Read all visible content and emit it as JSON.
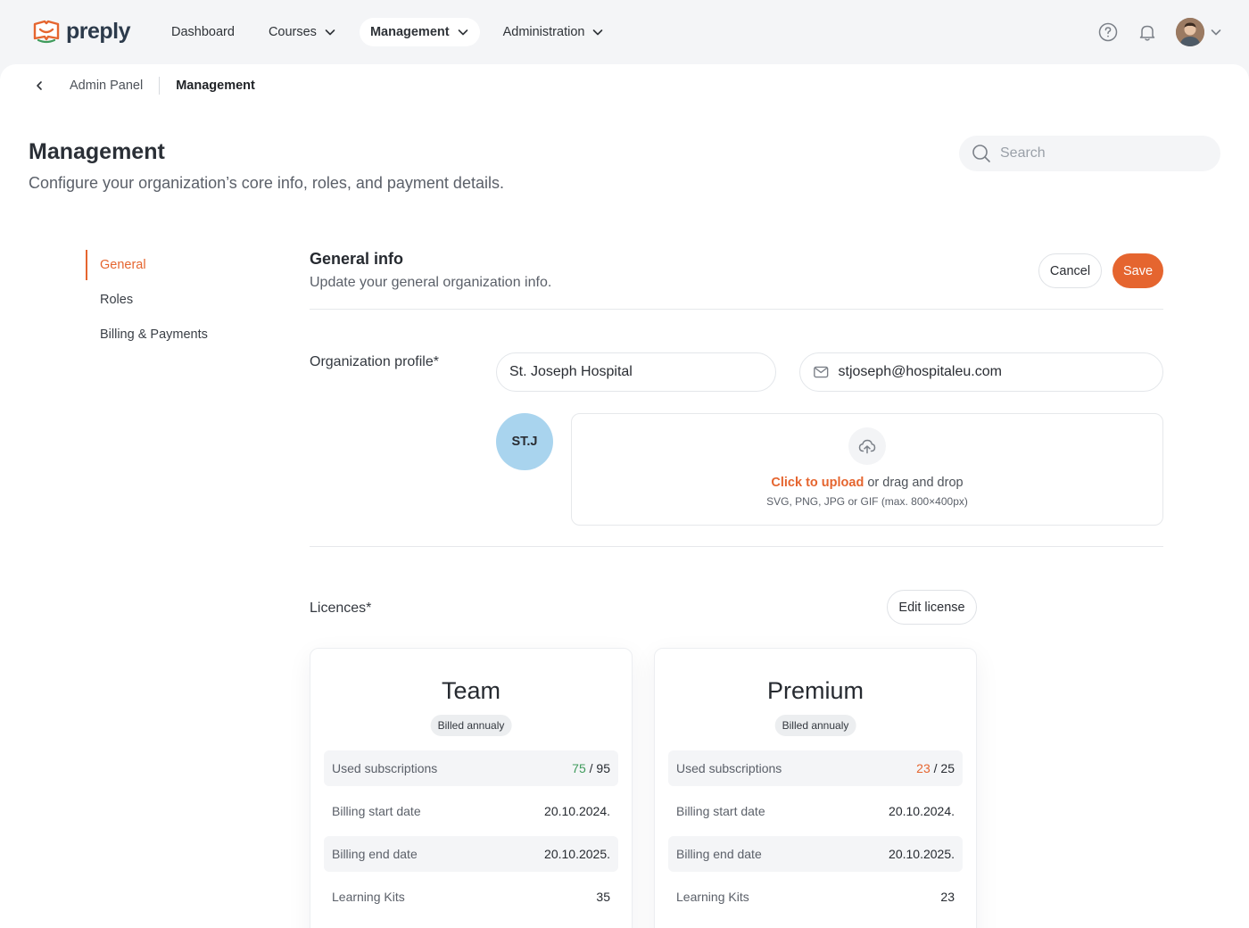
{
  "brand": {
    "name": "preply",
    "accent": "#e5652f"
  },
  "nav": {
    "items": [
      {
        "label": "Dashboard"
      },
      {
        "label": "Courses"
      },
      {
        "label": "Management"
      },
      {
        "label": "Administration"
      }
    ]
  },
  "breadcrumb": {
    "parent": "Admin Panel",
    "current": "Management"
  },
  "page": {
    "title": "Management",
    "subtitle": "Configure your organization’s core info, roles, and payment details."
  },
  "search": {
    "placeholder": "Search"
  },
  "sidebar": {
    "items": [
      {
        "label": "General"
      },
      {
        "label": "Roles"
      },
      {
        "label": "Billing & Payments"
      }
    ]
  },
  "general": {
    "title": "General info",
    "subtitle": "Update your general organization info.",
    "cancel_label": "Cancel",
    "save_label": "Save"
  },
  "org_profile": {
    "label": "Organization profile*",
    "name_value": "St. Joseph Hospital",
    "email_value": "stjoseph@hospitaleu.com",
    "avatar_initials": "ST.J",
    "upload": {
      "link_text": "Click to upload",
      "rest_text": " or drag and drop",
      "hint": "SVG, PNG, JPG or GIF (max. 800×400px)"
    }
  },
  "licences": {
    "label": "Licences*",
    "edit_label": "Edit license",
    "cards": [
      {
        "title": "Team",
        "billing_badge": "Billed annualy",
        "used_label": "Used subscriptions",
        "used": "75",
        "total": " / 95",
        "start_label": "Billing start date",
        "start_value": "20.10.2024.",
        "end_label": "Billing end date",
        "end_value": "20.10.2025.",
        "kits_label": "Learning Kits",
        "kits_value": "35"
      },
      {
        "title": "Premium",
        "billing_badge": "Billed annualy",
        "used_label": "Used subscriptions",
        "used": "23",
        "total": " / 25",
        "start_label": "Billing start date",
        "start_value": "20.10.2024.",
        "end_label": "Billing end date",
        "end_value": "20.10.2025.",
        "kits_label": "Learning Kits",
        "kits_value": "23"
      }
    ]
  }
}
